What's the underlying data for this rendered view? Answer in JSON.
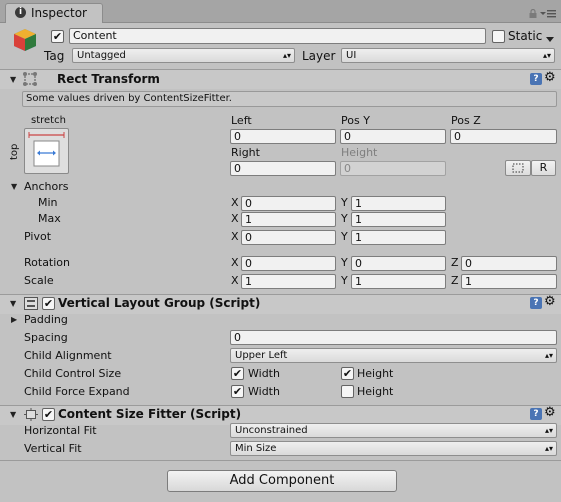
{
  "tab": {
    "title": "Inspector"
  },
  "object": {
    "name": "Content",
    "static_label": "Static",
    "tag_label": "Tag",
    "tag_value": "Untagged",
    "layer_label": "Layer",
    "layer_value": "UI",
    "active": true,
    "static": false
  },
  "rect_transform": {
    "title": "Rect Transform",
    "info": "Some values driven by ContentSizeFitter.",
    "anchor_h": "stretch",
    "anchor_v": "top",
    "left_label": "Left",
    "posy_label": "Pos Y",
    "posz_label": "Pos Z",
    "left": "0",
    "posy": "0",
    "posz": "0",
    "right_label": "Right",
    "height_label": "Height",
    "right": "0",
    "height": "0",
    "raw_button": "R",
    "anchors_label": "Anchors",
    "min_label": "Min",
    "max_label": "Max",
    "min_x": "0",
    "min_y": "1",
    "max_x": "1",
    "max_y": "1",
    "pivot_label": "Pivot",
    "pivot_x": "0",
    "pivot_y": "1",
    "rotation_label": "Rotation",
    "rot_x": "0",
    "rot_y": "0",
    "rot_z": "0",
    "scale_label": "Scale",
    "scale_x": "1",
    "scale_y": "1",
    "scale_z": "1",
    "x": "X",
    "y": "Y",
    "z": "Z"
  },
  "vlg": {
    "title": "Vertical Layout Group (Script)",
    "padding_label": "Padding",
    "spacing_label": "Spacing",
    "spacing": "0",
    "alignment_label": "Child Alignment",
    "alignment": "Upper Left",
    "control_label": "Child Control Size",
    "control_width": true,
    "control_height": true,
    "expand_label": "Child Force Expand",
    "expand_width": true,
    "expand_height": false,
    "width": "Width",
    "height": "Height"
  },
  "csf": {
    "title": "Content Size Fitter (Script)",
    "hfit_label": "Horizontal Fit",
    "hfit": "Unconstrained",
    "vfit_label": "Vertical Fit",
    "vfit": "Min Size"
  },
  "add_component": "Add Component",
  "check": "✔",
  "icons": {
    "tab": "info-icon",
    "lock": "lock-icon",
    "menu": "menu-icon",
    "help": "help-icon",
    "gear": "gear-icon"
  }
}
